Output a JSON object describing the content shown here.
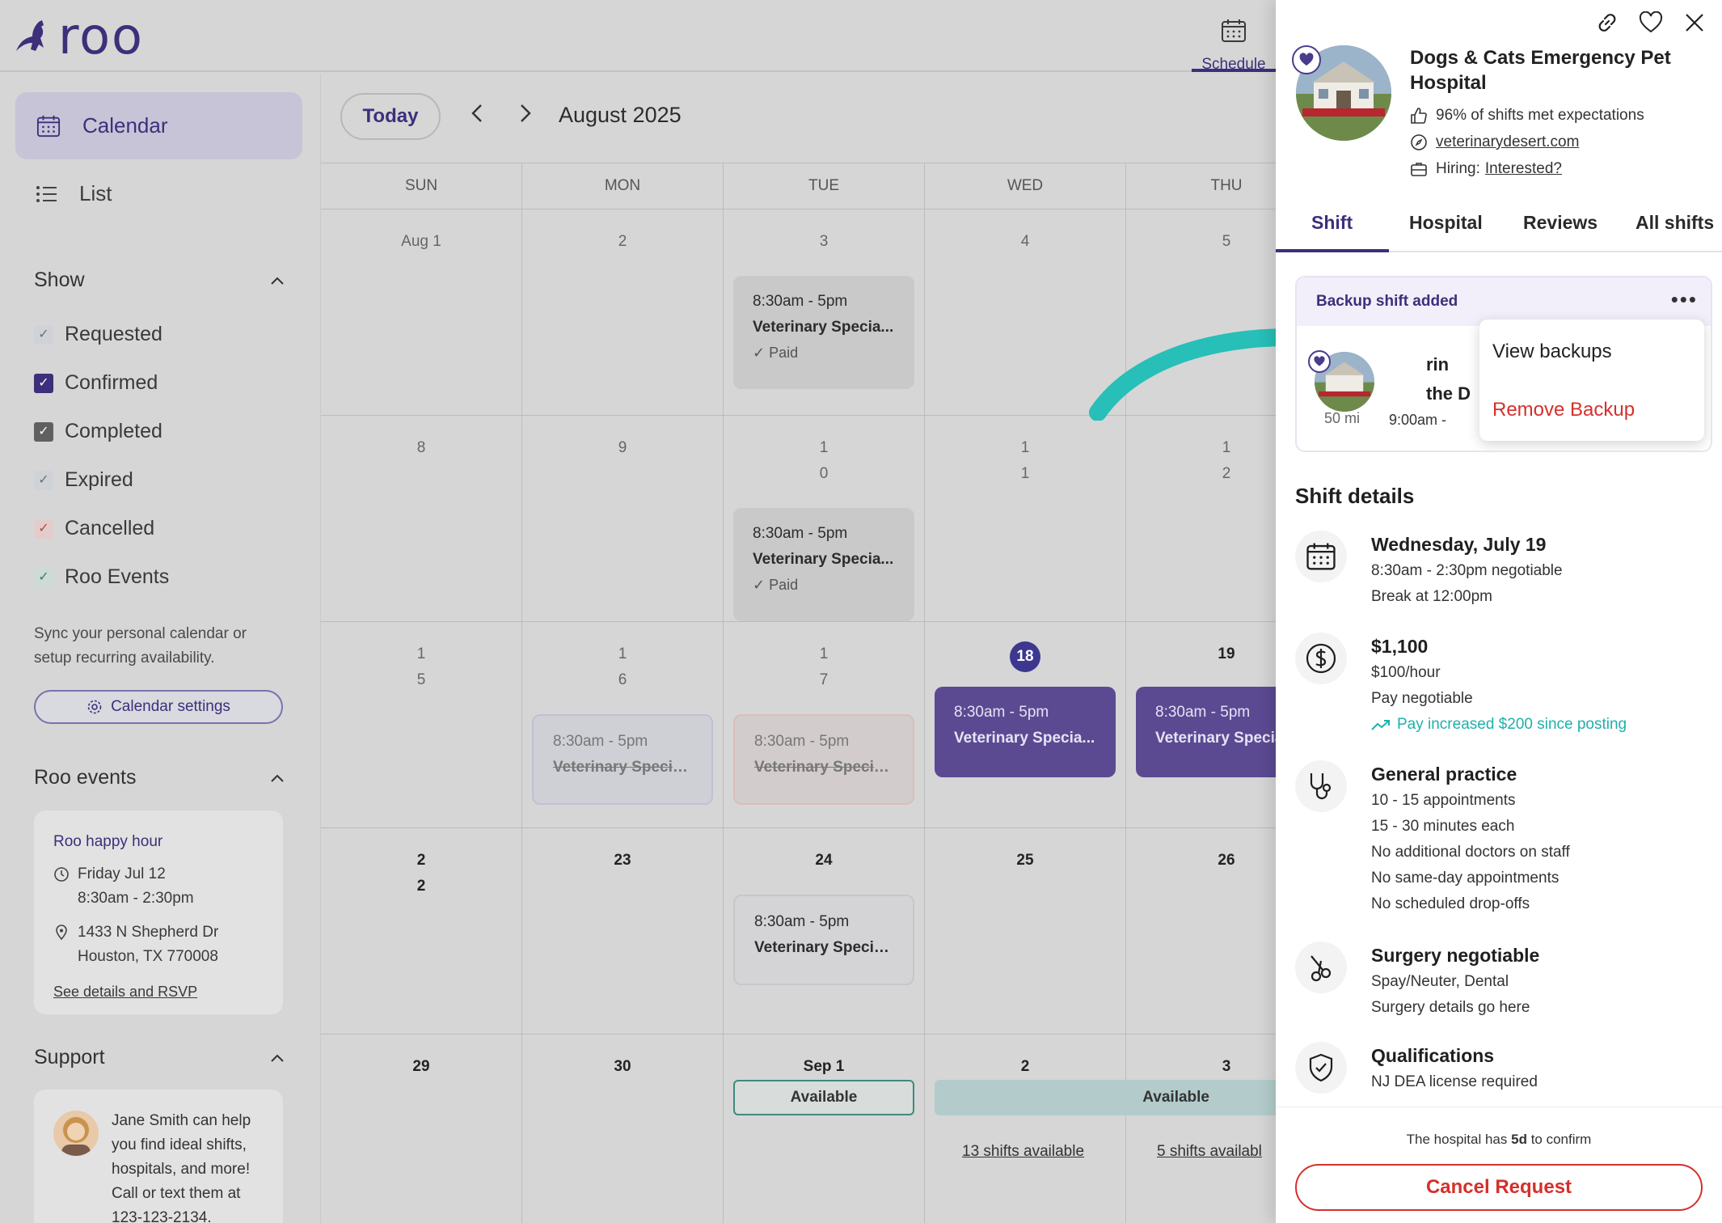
{
  "app": {
    "logo_text": "roo",
    "schedule_tab": "Schedule"
  },
  "sidebar": {
    "nav": [
      {
        "label": "Calendar"
      },
      {
        "label": "List"
      }
    ],
    "show_title": "Show",
    "filters": [
      "Requested",
      "Confirmed",
      "Completed",
      "Expired",
      "Cancelled",
      "Roo Events"
    ],
    "sync_text": "Sync your personal calendar or setup recurring availability.",
    "calendar_settings": "Calendar settings",
    "roo_events_title": "Roo events",
    "event": {
      "title": "Roo happy hour",
      "date": "Friday Jul 12",
      "time": "8:30am - 2:30pm",
      "address1": "1433 N Shepherd Dr",
      "address2": "Houston, TX 770008",
      "link": "See details and RSVP"
    },
    "support_title": "Support",
    "support": {
      "name": "Jane Smith",
      "text": "can help you find ideal shifts, hospitals, and more! Call or text them at 123-123-2134."
    }
  },
  "calendar": {
    "today": "Today",
    "month": "August 2025",
    "days": [
      "SUN",
      "MON",
      "TUE",
      "WED",
      "THU"
    ],
    "weeks": [
      [
        "Aug 1",
        "2",
        "3",
        "4",
        "5"
      ],
      [
        "8",
        "9",
        "1\n0",
        "1\n1",
        "1\n2"
      ],
      [
        "1\n5",
        "1\n6",
        "1\n7",
        "18",
        "19"
      ],
      [
        "2\n2",
        "23",
        "24",
        "25",
        "26"
      ],
      [
        "29",
        "30",
        "Sep 1",
        "2",
        "3"
      ]
    ],
    "shift_time": "8:30am - 5pm",
    "shift_title": "Veterinary Specia...",
    "paid": "Paid",
    "available": "Available",
    "wed_link": "13 shifts available",
    "thu_link": "5 shifts availabl"
  },
  "panel": {
    "hospital_name": "Dogs & Cats Emergency Pet Hospital",
    "expectations": "96% of shifts met expectations",
    "website": "veterinarydesert.com",
    "hiring_label": "Hiring:",
    "hiring_link": "Interested?",
    "tabs": [
      "Shift",
      "Hospital",
      "Reviews",
      "All shifts"
    ],
    "backup": {
      "label": "Backup shift added",
      "distance": "50 mi",
      "time": "9:00am -",
      "name_line1": "rin",
      "name_line2": "the D",
      "menu_view": "View backups",
      "menu_remove": "Remove Backup"
    },
    "details_title": "Shift details",
    "date": {
      "head": "Wednesday, July 19",
      "lines": [
        "8:30am - 2:30pm negotiable",
        "Break at 12:00pm"
      ]
    },
    "pay": {
      "head": "$1,100",
      "lines": [
        "$100/hour",
        "Pay negotiable"
      ],
      "increase": "Pay increased $200 since posting"
    },
    "practice": {
      "head": "General practice",
      "lines": [
        "10 - 15 appointments",
        "15 - 30 minutes each",
        "No additional doctors on staff",
        "No same-day appointments",
        "No scheduled drop-offs"
      ]
    },
    "surgery": {
      "head": "Surgery negotiable",
      "lines": [
        "Spay/Neuter, Dental",
        "Surgery details go here"
      ]
    },
    "qualifications": {
      "head": "Qualifications",
      "lines": [
        "NJ DEA license required"
      ]
    },
    "confirm_prefix": "The hospital has",
    "confirm_days": "5d",
    "confirm_suffix": "to confirm",
    "cancel_button": "Cancel Request"
  },
  "colors": {
    "brand": "#3d2f7a",
    "teal": "#1fb0ab",
    "danger": "#d4302c"
  }
}
